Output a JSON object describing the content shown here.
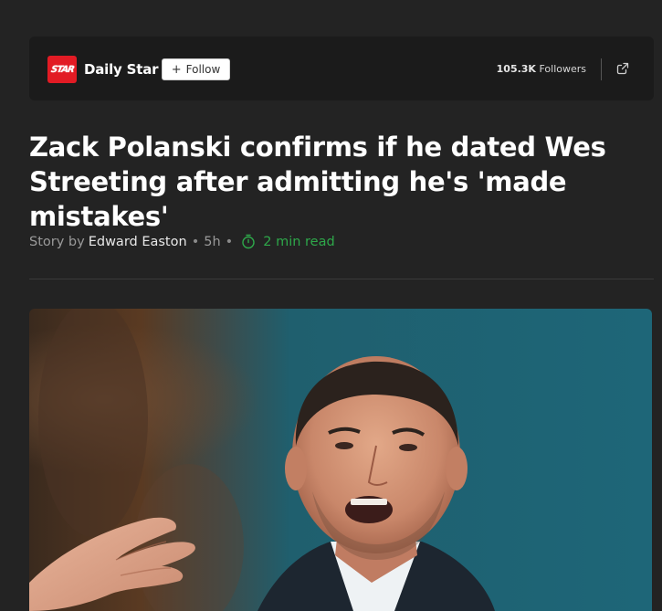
{
  "source": {
    "logo_text": "STAR",
    "publisher_name": "Daily Star",
    "follow_label": "Follow",
    "followers_count": "105.3K",
    "followers_label": "Followers",
    "share_icon": "external-link-icon"
  },
  "article": {
    "headline": "Zack Polanski confirms if he dated Wes Streeting after admitting he's 'made mistakes'",
    "story_by_label": "Story by",
    "author": "Edward Easton",
    "age": "5h",
    "read_time": "2 min read",
    "read_time_icon": "timer-icon",
    "accent_color": "#2ea84a"
  }
}
